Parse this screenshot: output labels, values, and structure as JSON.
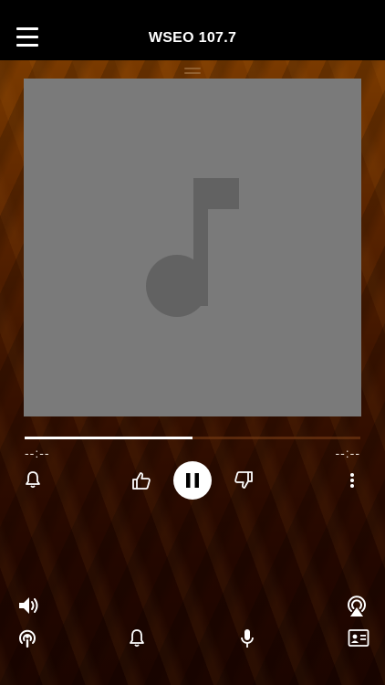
{
  "header": {
    "title": "WSEO 107.7",
    "menu_icon": "hamburger-menu-icon"
  },
  "player": {
    "artwork_icon": "music-note-icon",
    "progress": 0.5,
    "elapsed": "--:--",
    "remaining": "--:--",
    "state": "playing",
    "controls": {
      "alert": "bell-icon",
      "like": "thumbs-up-icon",
      "pause": "pause-icon",
      "dislike": "thumbs-down-icon",
      "more": "more-vertical-icon"
    }
  },
  "bottom_bar": {
    "volume": "speaker-volume-icon",
    "airplay": "airplay-icon",
    "podcast": "podcast-icon",
    "notifications": "bell-icon",
    "microphone": "microphone-icon",
    "contact": "contact-card-icon"
  },
  "colors": {
    "header_bg": "#000000",
    "artwork_bg": "#7a7a7a",
    "accent": "#ffffff",
    "background_top": "#7a3a00",
    "background_bottom": "#1c0500"
  }
}
